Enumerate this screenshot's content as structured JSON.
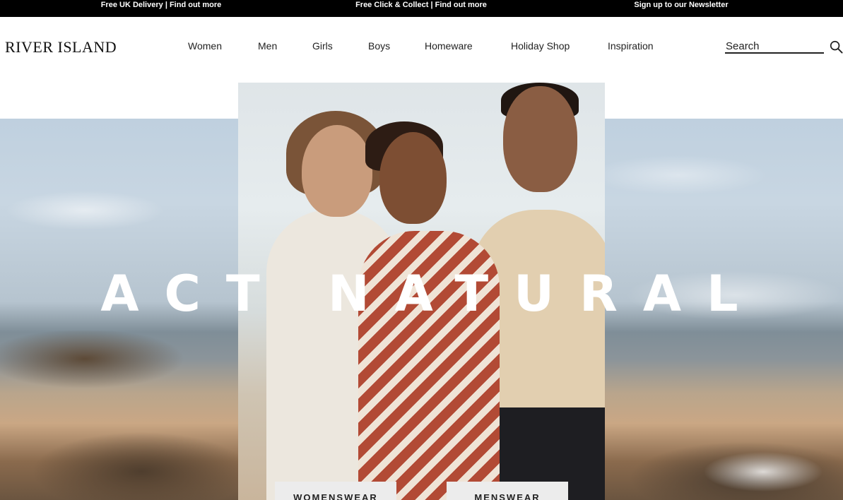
{
  "promo_bar": {
    "items": [
      {
        "text": "Free UK Delivery",
        "link": "Find out more"
      },
      {
        "text": "Free Click & Collect",
        "link": "Find out more"
      },
      {
        "text": "Sign up to our Newsletter",
        "link": ""
      }
    ],
    "separator": "|"
  },
  "header": {
    "logo": "RIVER ISLAND",
    "nav": [
      "Women",
      "Men",
      "Girls",
      "Boys",
      "Homeware",
      "Holiday Shop",
      "Inspiration"
    ],
    "search": {
      "placeholder": "Search",
      "icon": "search-icon"
    }
  },
  "hero": {
    "headline": "ACT NATURAL",
    "buttons": [
      "WOMENSWEAR",
      "MENSWEAR"
    ]
  },
  "colors": {
    "promo_bar_bg": "#000000",
    "text": "#222222",
    "cta_bg": "#ececec"
  }
}
